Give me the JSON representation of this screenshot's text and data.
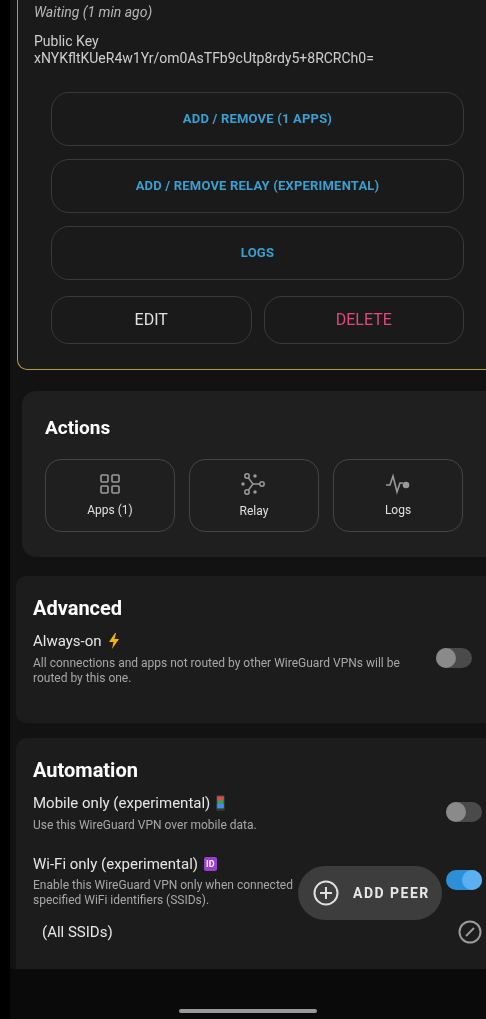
{
  "peer": {
    "status": "Waiting (1 min ago)",
    "public_key_label": "Public Key",
    "public_key": "xNYKfltKUeR4w1Yr/om0AsTFb9cUtp8rdy5+8RCRCh0=",
    "buttons": [
      {
        "label": "ADD / REMOVE (1 APPS)"
      },
      {
        "label": "ADD / REMOVE RELAY (EXPERIMENTAL)"
      },
      {
        "label": "LOGS"
      }
    ],
    "edit": "EDIT",
    "delete": "DELETE"
  },
  "actions": {
    "title": "Actions",
    "tiles": [
      {
        "label": "Apps (1)",
        "kind": "apps"
      },
      {
        "label": "Relay",
        "kind": "relay"
      },
      {
        "label": "Logs",
        "kind": "logs"
      }
    ]
  },
  "advanced": {
    "title": "Advanced",
    "settings": [
      {
        "title": "Always-on",
        "kind": "bolt",
        "description": "All connections and apps not routed by other WireGuard VPNs will be routed by this one.",
        "on": false
      }
    ]
  },
  "automation": {
    "title": "Automation",
    "settings": [
      {
        "title": "Mobile only (experimental)",
        "kind": "phone",
        "description": "Use this WireGuard VPN over mobile data.",
        "on": false
      },
      {
        "title": "Wi-Fi only (experimental)",
        "kind": "badge",
        "badge": "ID",
        "description": "Enable this WireGuard VPN only when connected",
        "description_continued": "specified WiFi identifiers (SSIDs).",
        "on": true
      }
    ],
    "ssids": "(All SSIDs)"
  },
  "fab": {
    "label": "ADD PEER"
  }
}
